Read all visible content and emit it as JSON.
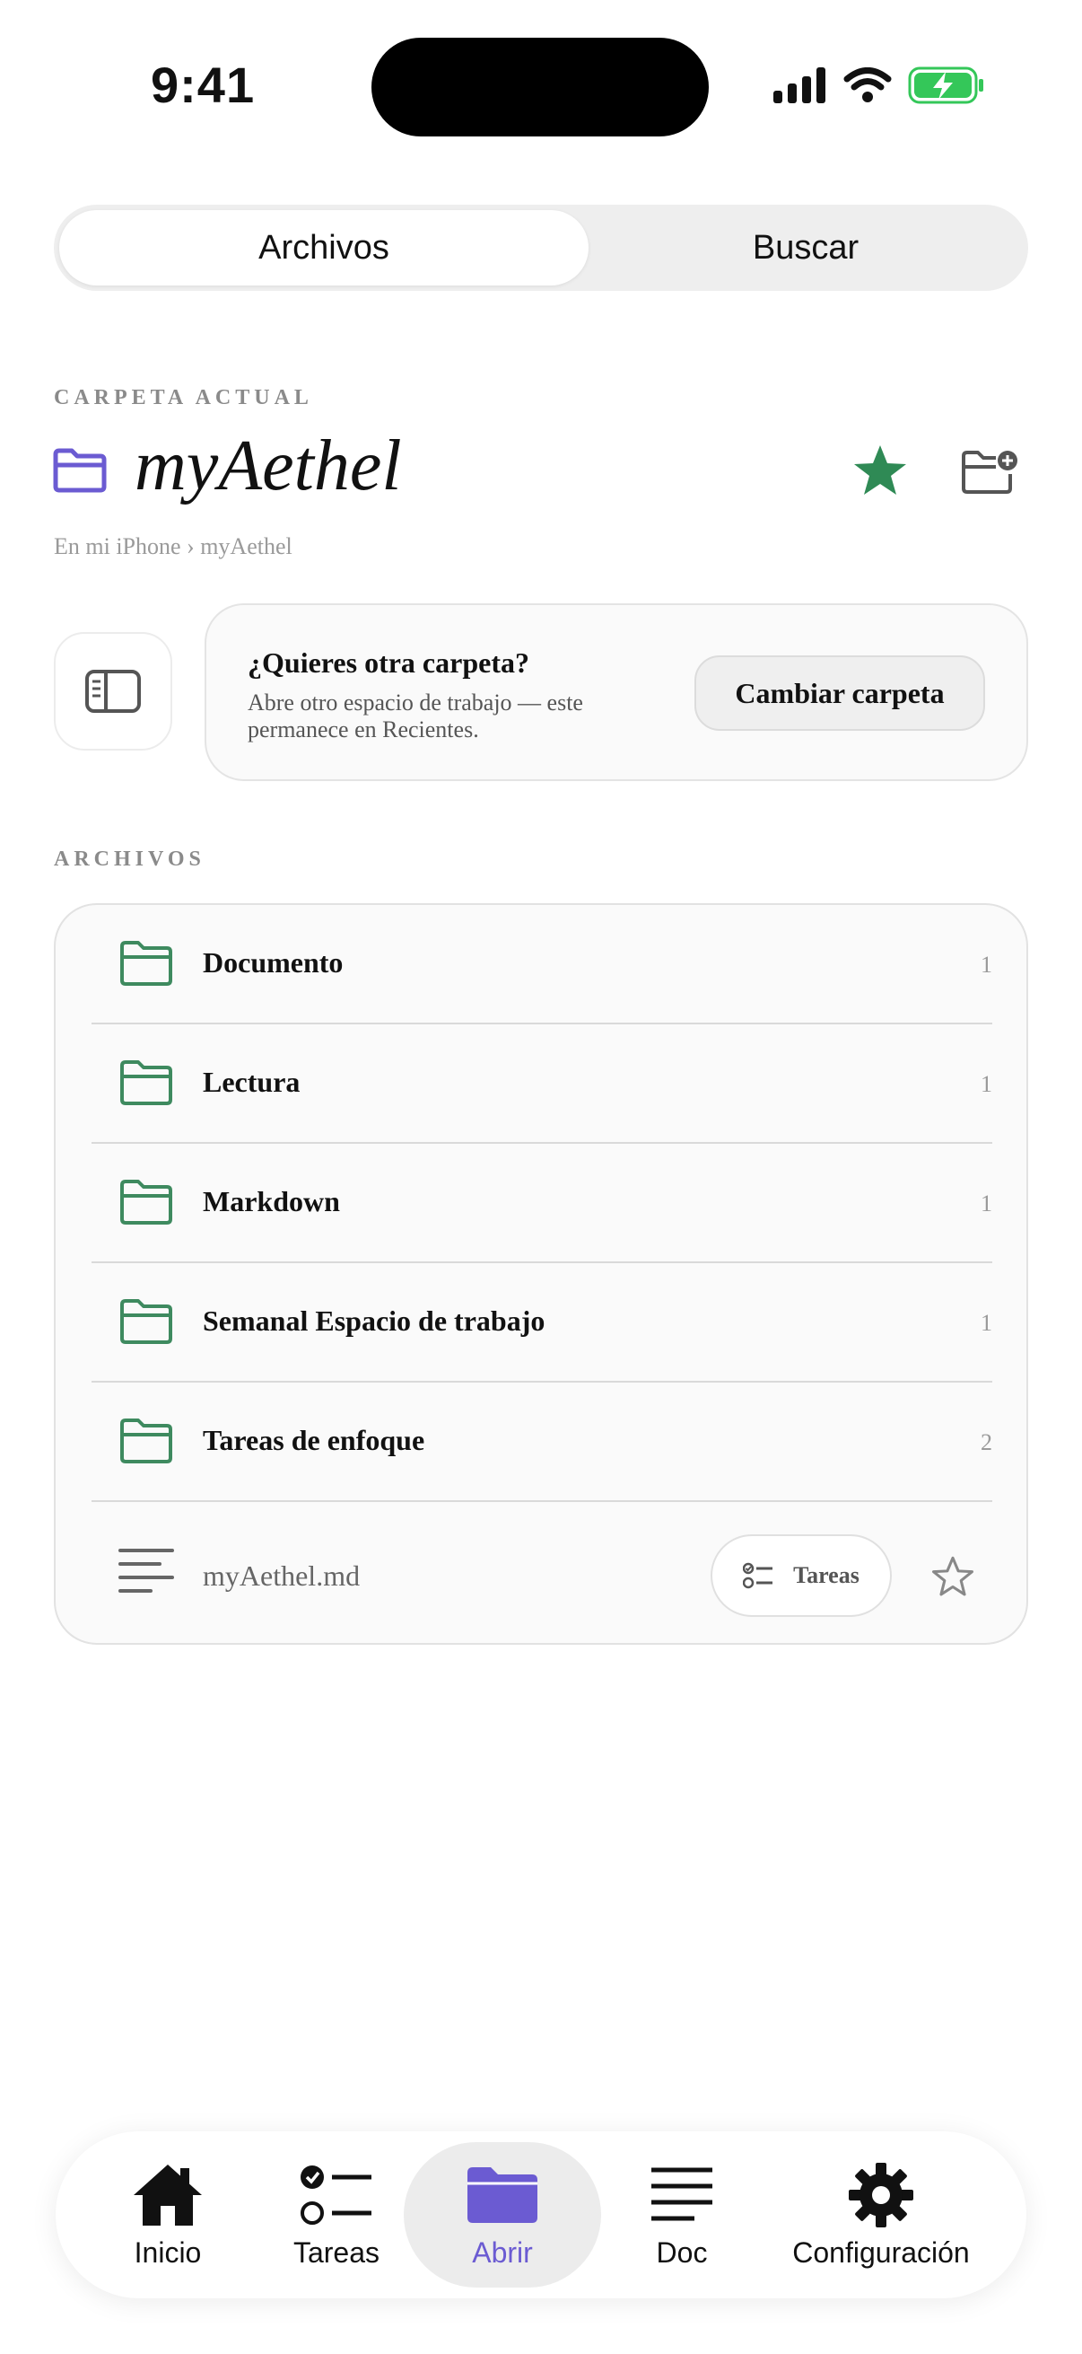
{
  "status": {
    "time": "9:41"
  },
  "segmented": {
    "tabs": [
      "Archivos",
      "Buscar"
    ],
    "active": "Archivos"
  },
  "current_folder": {
    "section_label": "CARPETA ACTUAL",
    "name": "myAethel",
    "breadcrumb": "En mi iPhone › myAethel"
  },
  "promo": {
    "title": "¿Quieres otra carpeta?",
    "subtitle": "Abre otro espacio de trabajo — este permanece en Recientes.",
    "button": "Cambiar carpeta"
  },
  "files": {
    "section_label": "ARCHIVOS",
    "folders": [
      {
        "name": "Documento",
        "count": "1"
      },
      {
        "name": "Lectura",
        "count": "1"
      },
      {
        "name": "Markdown",
        "count": "1"
      },
      {
        "name": "Semanal Espacio de trabajo",
        "count": "1"
      },
      {
        "name": "Tareas de enfoque",
        "count": "2"
      }
    ],
    "file": {
      "name": "myAethel.md",
      "chip": "Tareas"
    }
  },
  "tabbar": {
    "items": [
      {
        "label": "Inicio",
        "icon": "home-icon"
      },
      {
        "label": "Tareas",
        "icon": "tasks-icon"
      },
      {
        "label": "Abrir",
        "icon": "folder-icon"
      },
      {
        "label": "Doc",
        "icon": "document-icon"
      },
      {
        "label": "Configuración",
        "icon": "gear-icon"
      }
    ],
    "active": "Abrir"
  },
  "colors": {
    "accent": "#6b5bd2",
    "folder_green": "#3e8a5f",
    "star_green": "#2f8a55"
  }
}
